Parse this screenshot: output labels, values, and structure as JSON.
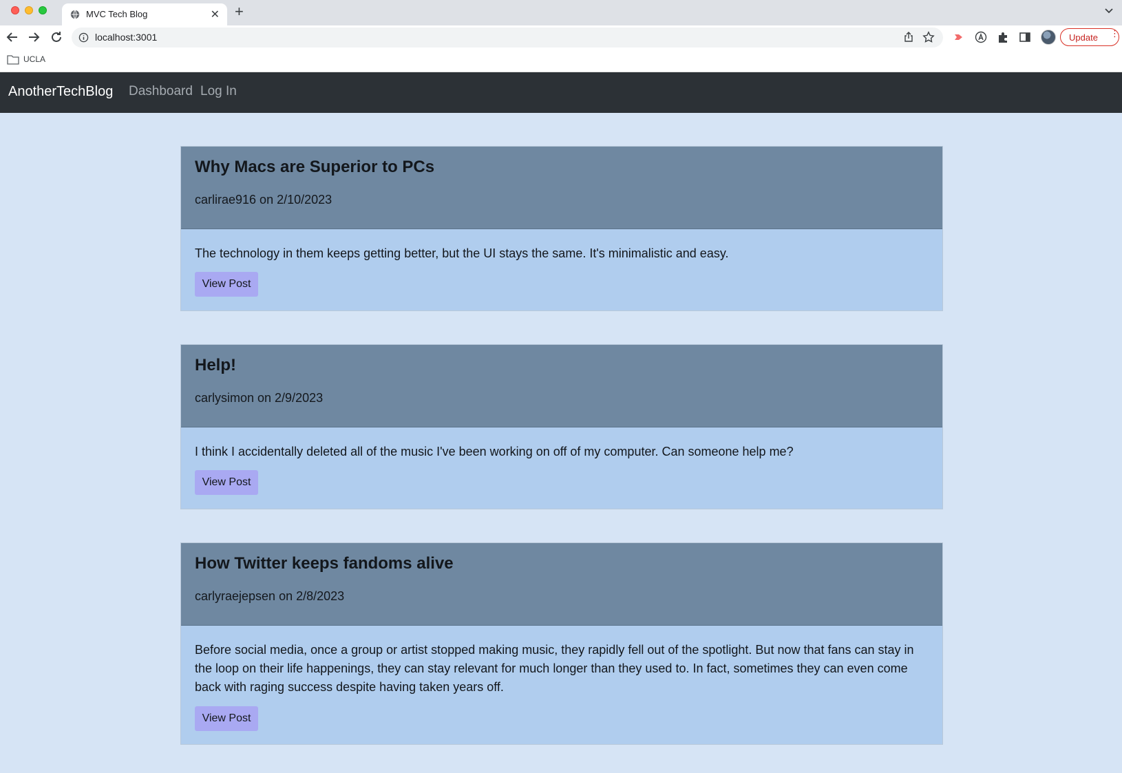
{
  "browser": {
    "tab_title": "MVC Tech Blog",
    "tab_close_glyph": "✕",
    "new_tab_glyph": "+",
    "url": "localhost:3001",
    "update_label": "Update",
    "bookmark_label": "UCLA"
  },
  "site": {
    "brand": "AnotherTechBlog",
    "nav": [
      {
        "label": "Dashboard"
      },
      {
        "label": "Log In"
      }
    ]
  },
  "posts": [
    {
      "title": "Why Macs are Superior to PCs",
      "meta": "carlirae916 on 2/10/2023",
      "body": "The technology in them keeps getting better, but the UI stays the same. It's minimalistic and easy.",
      "button": "View Post"
    },
    {
      "title": "Help!",
      "meta": "carlysimon on 2/9/2023",
      "body": "I think I accidentally deleted all of the music I've been working on off of my computer. Can someone help me?",
      "button": "View Post"
    },
    {
      "title": "How Twitter keeps fandoms alive",
      "meta": "carlyraejepsen on 2/8/2023",
      "body": "Before social media, once a group or artist stopped making music, they rapidly fell out of the spotlight. But now that fans can stay in the loop on their life happenings, they can stay relevant for much longer than they used to. In fact, sometimes they can even come back with raging success despite having taken years off.",
      "button": "View Post"
    }
  ],
  "colors": {
    "page_bg": "#d6e4f5",
    "navbar_bg": "#2c3136",
    "card_header_bg": "#6f88a1",
    "card_body_bg": "#b0cdee",
    "button_bg": "#a9a9f2"
  }
}
